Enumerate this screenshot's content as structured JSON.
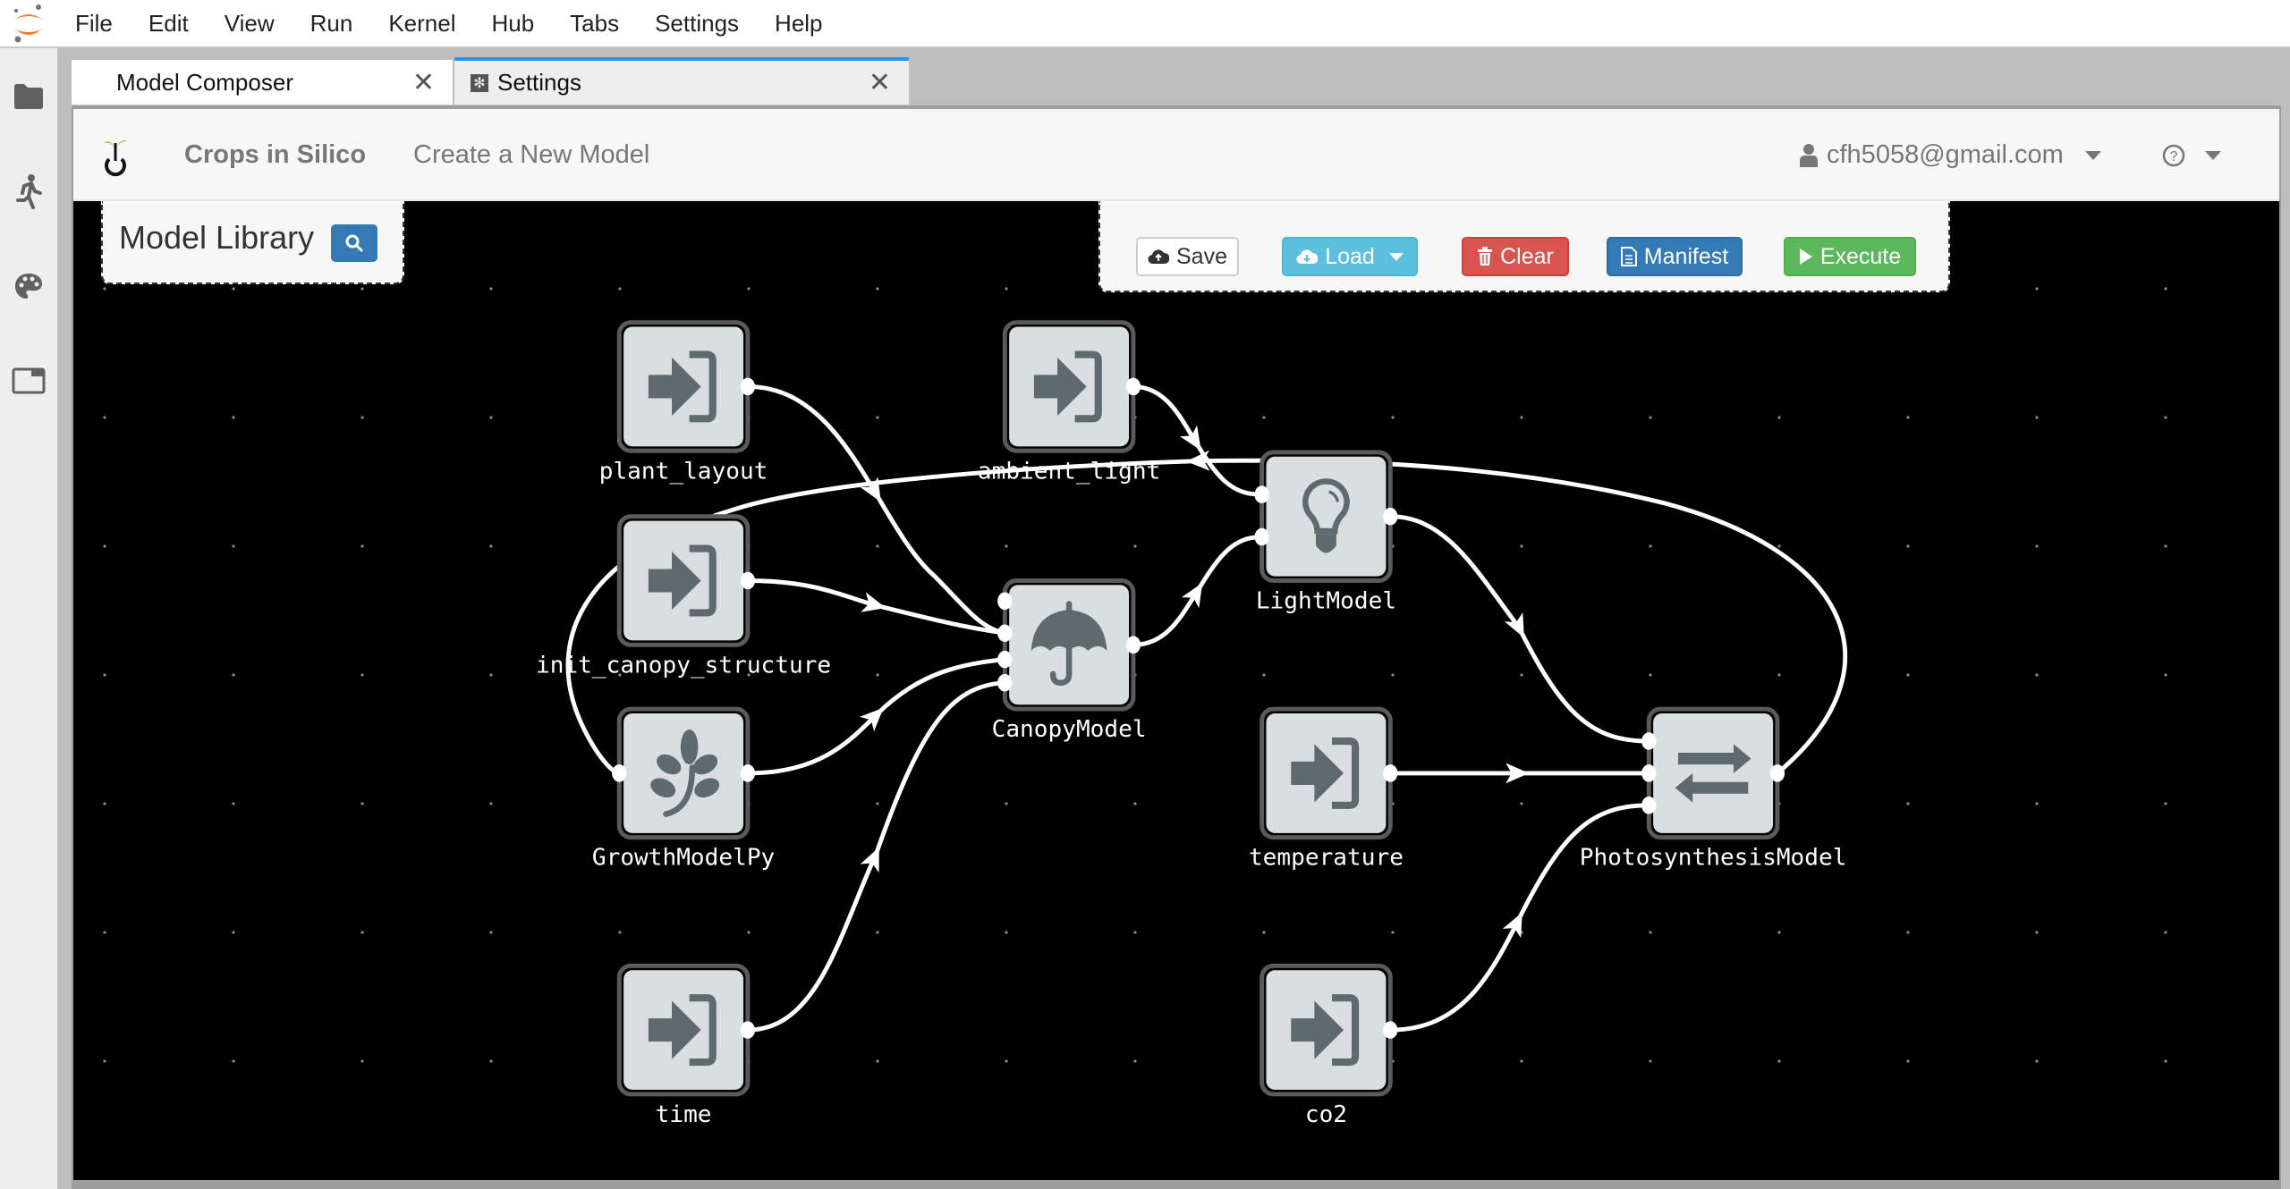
{
  "menubar": {
    "items": [
      "File",
      "Edit",
      "View",
      "Run",
      "Kernel",
      "Hub",
      "Tabs",
      "Settings",
      "Help"
    ]
  },
  "sidebar": {
    "icons": [
      "folder-icon",
      "running-icon",
      "palette-icon",
      "tabs-icon"
    ]
  },
  "tabs": [
    {
      "label": "Model Composer",
      "active": true
    },
    {
      "label": "Settings",
      "active": false,
      "icon": "gear-icon"
    }
  ],
  "header": {
    "brand": "Crops in Silico",
    "nav_link": "Create a New Model",
    "user": "cfh5058@gmail.com"
  },
  "library": {
    "title": "Model Library"
  },
  "toolbar": {
    "save": "Save",
    "load": "Load",
    "clear": "Clear",
    "manifest": "Manifest",
    "execute": "Execute"
  },
  "colors": {
    "accent_tab": "#2196f3",
    "btn_info": "#5bc0de",
    "btn_danger": "#d9534f",
    "btn_primary": "#337ab7",
    "btn_success": "#5cb85c",
    "node_fill": "#d9dfe0",
    "node_icon": "#5f6a6e"
  },
  "graph": {
    "nodes": [
      {
        "id": "plant_layout",
        "label": "plant_layout",
        "icon": "input"
      },
      {
        "id": "ambient_light",
        "label": "ambient_light",
        "icon": "input"
      },
      {
        "id": "init_canopy_structure",
        "label": "init_canopy_structure",
        "icon": "input"
      },
      {
        "id": "CanopyModel",
        "label": "CanopyModel",
        "icon": "umbrella"
      },
      {
        "id": "LightModel",
        "label": "LightModel",
        "icon": "lightbulb"
      },
      {
        "id": "GrowthModelPy",
        "label": "GrowthModelPy",
        "icon": "leaf"
      },
      {
        "id": "temperature",
        "label": "temperature",
        "icon": "input"
      },
      {
        "id": "PhotosynthesisModel",
        "label": "PhotosynthesisModel",
        "icon": "exchange"
      },
      {
        "id": "time",
        "label": "time",
        "icon": "input"
      },
      {
        "id": "co2",
        "label": "co2",
        "icon": "input"
      }
    ],
    "edges": [
      {
        "from": "plant_layout",
        "to": "CanopyModel"
      },
      {
        "from": "init_canopy_structure",
        "to": "CanopyModel"
      },
      {
        "from": "GrowthModelPy",
        "to": "CanopyModel"
      },
      {
        "from": "time",
        "to": "CanopyModel"
      },
      {
        "from": "ambient_light",
        "to": "LightModel"
      },
      {
        "from": "CanopyModel",
        "to": "LightModel"
      },
      {
        "from": "LightModel",
        "to": "PhotosynthesisModel"
      },
      {
        "from": "temperature",
        "to": "PhotosynthesisModel"
      },
      {
        "from": "co2",
        "to": "PhotosynthesisModel"
      },
      {
        "from": "PhotosynthesisModel",
        "to": "GrowthModelPy"
      }
    ]
  }
}
